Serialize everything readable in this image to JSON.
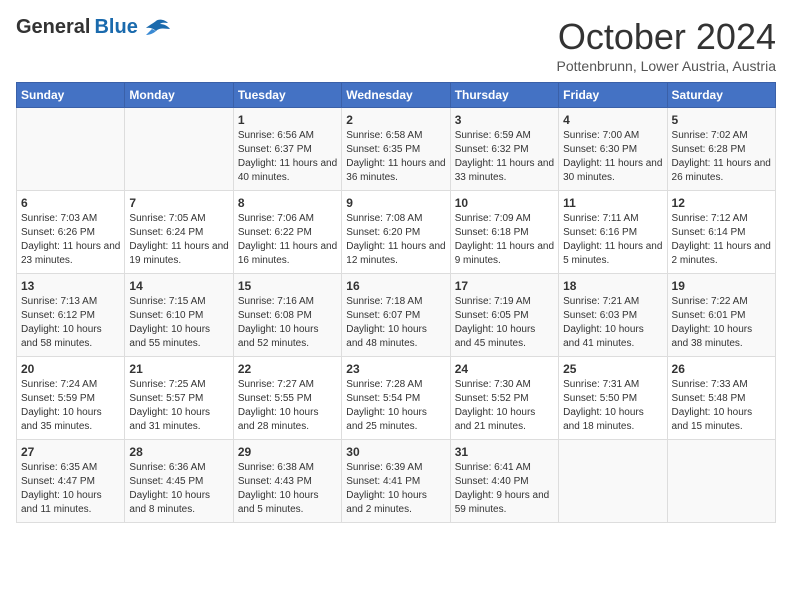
{
  "header": {
    "logo_general": "General",
    "logo_blue": "Blue",
    "month": "October 2024",
    "location": "Pottenbrunn, Lower Austria, Austria"
  },
  "days_of_week": [
    "Sunday",
    "Monday",
    "Tuesday",
    "Wednesday",
    "Thursday",
    "Friday",
    "Saturday"
  ],
  "weeks": [
    [
      {
        "day": "",
        "info": ""
      },
      {
        "day": "",
        "info": ""
      },
      {
        "day": "1",
        "info": "Sunrise: 6:56 AM\nSunset: 6:37 PM\nDaylight: 11 hours and 40 minutes."
      },
      {
        "day": "2",
        "info": "Sunrise: 6:58 AM\nSunset: 6:35 PM\nDaylight: 11 hours and 36 minutes."
      },
      {
        "day": "3",
        "info": "Sunrise: 6:59 AM\nSunset: 6:32 PM\nDaylight: 11 hours and 33 minutes."
      },
      {
        "day": "4",
        "info": "Sunrise: 7:00 AM\nSunset: 6:30 PM\nDaylight: 11 hours and 30 minutes."
      },
      {
        "day": "5",
        "info": "Sunrise: 7:02 AM\nSunset: 6:28 PM\nDaylight: 11 hours and 26 minutes."
      }
    ],
    [
      {
        "day": "6",
        "info": "Sunrise: 7:03 AM\nSunset: 6:26 PM\nDaylight: 11 hours and 23 minutes."
      },
      {
        "day": "7",
        "info": "Sunrise: 7:05 AM\nSunset: 6:24 PM\nDaylight: 11 hours and 19 minutes."
      },
      {
        "day": "8",
        "info": "Sunrise: 7:06 AM\nSunset: 6:22 PM\nDaylight: 11 hours and 16 minutes."
      },
      {
        "day": "9",
        "info": "Sunrise: 7:08 AM\nSunset: 6:20 PM\nDaylight: 11 hours and 12 minutes."
      },
      {
        "day": "10",
        "info": "Sunrise: 7:09 AM\nSunset: 6:18 PM\nDaylight: 11 hours and 9 minutes."
      },
      {
        "day": "11",
        "info": "Sunrise: 7:11 AM\nSunset: 6:16 PM\nDaylight: 11 hours and 5 minutes."
      },
      {
        "day": "12",
        "info": "Sunrise: 7:12 AM\nSunset: 6:14 PM\nDaylight: 11 hours and 2 minutes."
      }
    ],
    [
      {
        "day": "13",
        "info": "Sunrise: 7:13 AM\nSunset: 6:12 PM\nDaylight: 10 hours and 58 minutes."
      },
      {
        "day": "14",
        "info": "Sunrise: 7:15 AM\nSunset: 6:10 PM\nDaylight: 10 hours and 55 minutes."
      },
      {
        "day": "15",
        "info": "Sunrise: 7:16 AM\nSunset: 6:08 PM\nDaylight: 10 hours and 52 minutes."
      },
      {
        "day": "16",
        "info": "Sunrise: 7:18 AM\nSunset: 6:07 PM\nDaylight: 10 hours and 48 minutes."
      },
      {
        "day": "17",
        "info": "Sunrise: 7:19 AM\nSunset: 6:05 PM\nDaylight: 10 hours and 45 minutes."
      },
      {
        "day": "18",
        "info": "Sunrise: 7:21 AM\nSunset: 6:03 PM\nDaylight: 10 hours and 41 minutes."
      },
      {
        "day": "19",
        "info": "Sunrise: 7:22 AM\nSunset: 6:01 PM\nDaylight: 10 hours and 38 minutes."
      }
    ],
    [
      {
        "day": "20",
        "info": "Sunrise: 7:24 AM\nSunset: 5:59 PM\nDaylight: 10 hours and 35 minutes."
      },
      {
        "day": "21",
        "info": "Sunrise: 7:25 AM\nSunset: 5:57 PM\nDaylight: 10 hours and 31 minutes."
      },
      {
        "day": "22",
        "info": "Sunrise: 7:27 AM\nSunset: 5:55 PM\nDaylight: 10 hours and 28 minutes."
      },
      {
        "day": "23",
        "info": "Sunrise: 7:28 AM\nSunset: 5:54 PM\nDaylight: 10 hours and 25 minutes."
      },
      {
        "day": "24",
        "info": "Sunrise: 7:30 AM\nSunset: 5:52 PM\nDaylight: 10 hours and 21 minutes."
      },
      {
        "day": "25",
        "info": "Sunrise: 7:31 AM\nSunset: 5:50 PM\nDaylight: 10 hours and 18 minutes."
      },
      {
        "day": "26",
        "info": "Sunrise: 7:33 AM\nSunset: 5:48 PM\nDaylight: 10 hours and 15 minutes."
      }
    ],
    [
      {
        "day": "27",
        "info": "Sunrise: 6:35 AM\nSunset: 4:47 PM\nDaylight: 10 hours and 11 minutes."
      },
      {
        "day": "28",
        "info": "Sunrise: 6:36 AM\nSunset: 4:45 PM\nDaylight: 10 hours and 8 minutes."
      },
      {
        "day": "29",
        "info": "Sunrise: 6:38 AM\nSunset: 4:43 PM\nDaylight: 10 hours and 5 minutes."
      },
      {
        "day": "30",
        "info": "Sunrise: 6:39 AM\nSunset: 4:41 PM\nDaylight: 10 hours and 2 minutes."
      },
      {
        "day": "31",
        "info": "Sunrise: 6:41 AM\nSunset: 4:40 PM\nDaylight: 9 hours and 59 minutes."
      },
      {
        "day": "",
        "info": ""
      },
      {
        "day": "",
        "info": ""
      }
    ]
  ]
}
